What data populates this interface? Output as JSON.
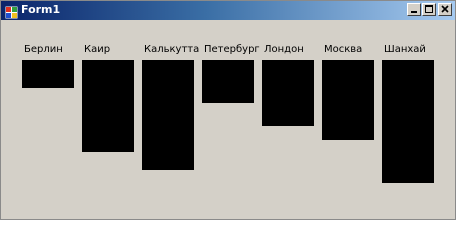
{
  "window": {
    "title": "Form1",
    "buttons": [
      "minimize",
      "maximize",
      "close"
    ]
  },
  "chart_data": {
    "type": "bar",
    "categories": [
      "Берлин",
      "Каир",
      "Калькутта",
      "Петербург",
      "Лондон",
      "Москва",
      "Шанхай"
    ],
    "values": [
      28,
      92,
      110,
      43,
      66,
      80,
      123
    ],
    "color": "#000000",
    "orientation": "bars hang downward from a common top line"
  },
  "icons": {
    "app": "form-icon",
    "minimize": "minimize-icon",
    "maximize": "maximize-icon",
    "close": "close-icon"
  }
}
